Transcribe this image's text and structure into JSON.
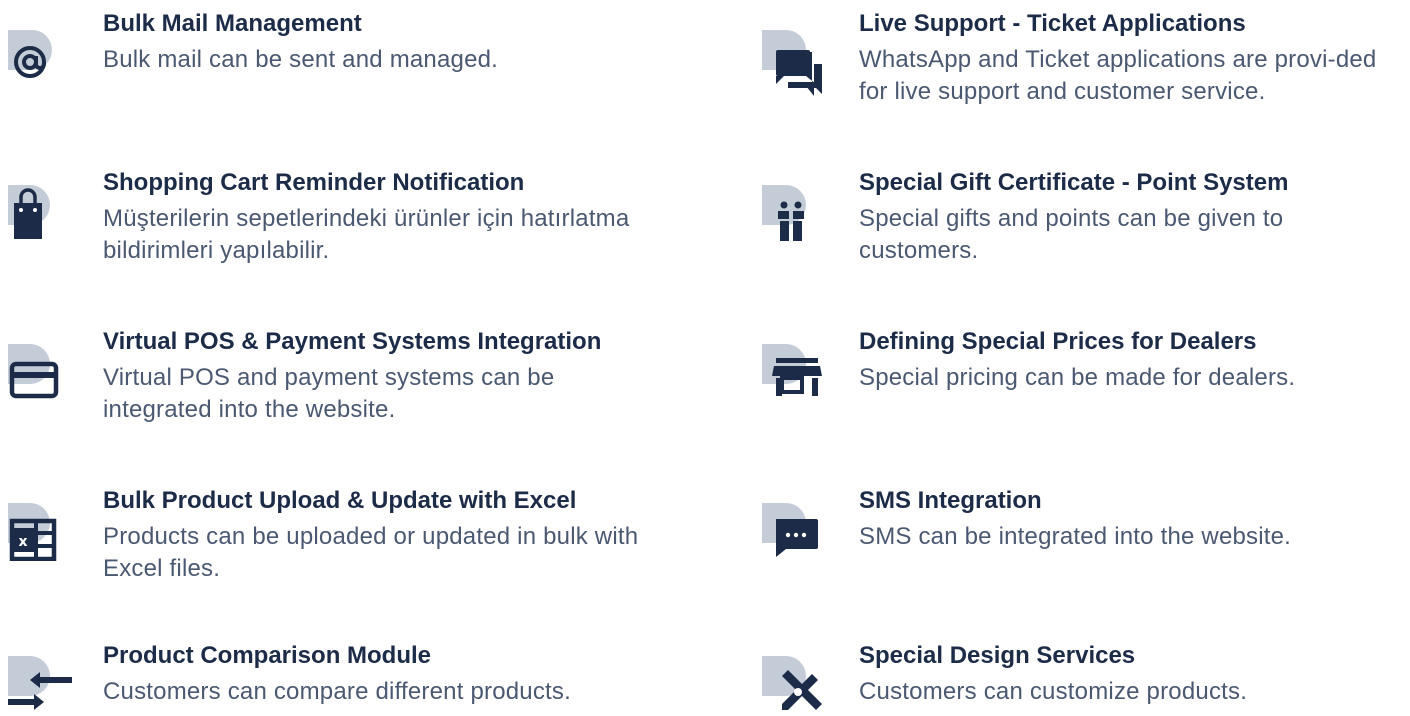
{
  "features": [
    {
      "title": "Bulk Mail Management",
      "desc": "Bulk mail can be sent and managed.",
      "icon": "at-icon"
    },
    {
      "title": "Live Support - Ticket Applications",
      "desc": "WhatsApp and Ticket applications are provi-ded for live support and customer service.",
      "icon": "chat-bubbles-icon"
    },
    {
      "title": "Shopping Cart Reminder Notification",
      "desc": "Müşterilerin sepetlerindeki ürünler için hatırlatma bildirimleri yapılabilir.",
      "icon": "shopping-bag-icon"
    },
    {
      "title": "Special Gift Certificate - Point System",
      "desc": "Special gifts and points can be given to customers.",
      "icon": "gift-icon"
    },
    {
      "title": "Virtual POS & Payment Systems Integration",
      "desc": "Virtual POS and payment systems can be integrated into the website.",
      "icon": "credit-card-icon"
    },
    {
      "title": "Defining Special Prices for Dealers",
      "desc": "Special pricing can be made for dealers.",
      "icon": "store-icon"
    },
    {
      "title": "Bulk Product Upload & Update with Excel",
      "desc": "Products can be uploaded or updated in bulk with Excel files.",
      "icon": "excel-icon"
    },
    {
      "title": "SMS Integration",
      "desc": "SMS can be integrated into the website.",
      "icon": "sms-icon"
    },
    {
      "title": "Product Comparison Module",
      "desc": "Customers can compare different products.",
      "icon": "compare-arrows-icon"
    },
    {
      "title": "Special Design Services",
      "desc": "Customers can customize products.",
      "icon": "design-tools-icon"
    }
  ],
  "colors": {
    "icon_dark": "#1c2b47",
    "icon_blob": "#c4ccd8",
    "title": "#1c2b47",
    "desc": "#4a5872"
  }
}
